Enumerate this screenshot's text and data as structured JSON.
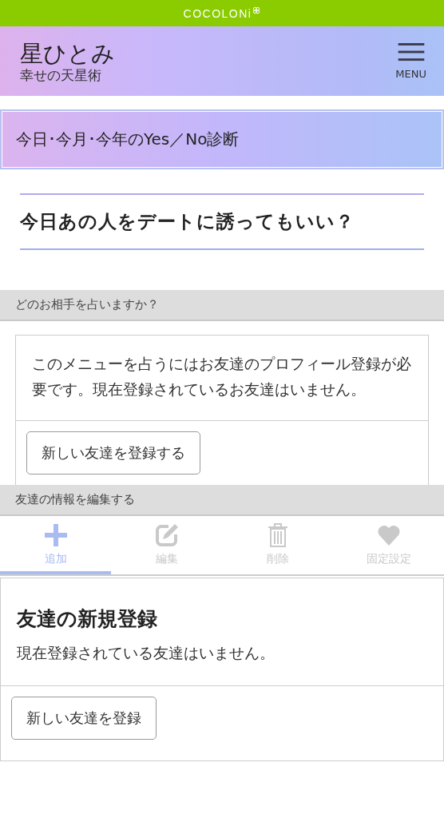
{
  "brand": {
    "logo": "COCOLONi"
  },
  "header": {
    "title": "星ひとみ",
    "subtitle": "幸せの天星術",
    "menu_label": "MENU"
  },
  "page_title": "今日･今月･今年のYes／No診断",
  "question": "今日あの人をデートに誘ってもいい？",
  "partner_section": {
    "heading": "どのお相手を占いますか？",
    "message": "このメニューを占うにはお友達のプロフィール登録が必要です。現在登録されているお友達はいません。",
    "button": "新しい友達を登録する"
  },
  "edit_section": {
    "heading": "友達の情報を編集する"
  },
  "tabs": [
    {
      "kind": "add",
      "label": "追加",
      "selected": true
    },
    {
      "kind": "edit",
      "label": "編集",
      "selected": false
    },
    {
      "kind": "delete",
      "label": "削除",
      "selected": false
    },
    {
      "kind": "pin",
      "label": "固定設定",
      "selected": false
    }
  ],
  "register_card": {
    "title": "友達の新規登録",
    "message": "現在登録されている友達はいません。",
    "button": "新しい友達を登録"
  }
}
